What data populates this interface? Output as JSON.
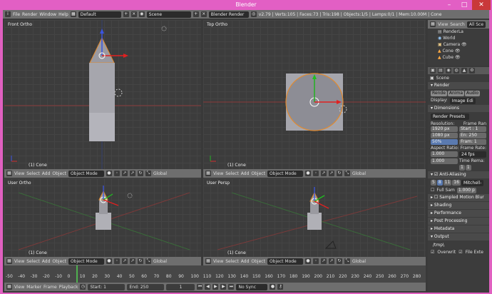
{
  "window": {
    "title": "Blender"
  },
  "menubar": {
    "items": [
      "File",
      "Render",
      "Window",
      "Help"
    ],
    "screen_layout": "Default",
    "scene": "Scene",
    "engine": "Blender Render",
    "stats": "v2.79 | Verts:105 | Faces:73 | Tris:198 | Objects:1/5 | Lamps:0/1 | Mem:10.00M | Cone"
  },
  "viewports": [
    {
      "label": "Front Ortho",
      "object": "(1) Cone"
    },
    {
      "label": "Top Ortho",
      "object": "(1) Cone"
    },
    {
      "label": "User Ortho",
      "object": "(1) Cone"
    },
    {
      "label": "User Persp",
      "object": "(1) Cone"
    }
  ],
  "vp_header": {
    "view": "View",
    "select": "Select",
    "add": "Add",
    "object": "Object",
    "mode": "Object Mode",
    "orientation": "Global"
  },
  "outliner": {
    "view": "View",
    "search": "Search",
    "all_scenes": "All Sce",
    "items": [
      "RenderLa",
      "World",
      "Camera",
      "Cone",
      "Cube"
    ]
  },
  "properties": {
    "scene_label": "Scene",
    "render": {
      "title": "Render",
      "buttons": [
        "Rende",
        "Anima",
        "Audio"
      ],
      "display_label": "Display:",
      "display_value": "Image Edi"
    },
    "dimensions": {
      "title": "Dimensions",
      "presets": "Render Presets",
      "resolution_label": "Resolution:",
      "frame_range_label": "Frame Ran",
      "res_x": "1920 px",
      "res_y": "1080 px",
      "res_pct": "50%",
      "start": "Start : 1",
      "end": "En: 250",
      "frame": "Fram: 1",
      "aspect_label": "Aspect Ratio:",
      "framerate_label": "Frame Rate:",
      "aspect_x": "1.000",
      "aspect_y": "1.000",
      "fps": "24 fps",
      "time_remap": "Time Rema:",
      "remap_old": "1",
      "remap_new": "1"
    },
    "antialias": {
      "title": "Anti-Aliasing",
      "samples": [
        "5",
        "8",
        "11",
        "16"
      ],
      "filter": "Mitchell-",
      "full_sample": "Full Sam",
      "filter_size": "1.000 p"
    },
    "sections": [
      "Sampled Motion Blur",
      "Shading",
      "Performance",
      "Post Processing",
      "Metadata",
      "Output"
    ],
    "output_path": "/tmp\\",
    "overwrite": "Overwrit",
    "file_ext": "File Exte"
  },
  "timeline": {
    "ticks": [
      "-50",
      "-40",
      "-30",
      "-20",
      "-10",
      "0",
      "10",
      "20",
      "30",
      "40",
      "50",
      "60",
      "70",
      "80",
      "90",
      "100",
      "110",
      "120",
      "130",
      "140",
      "150",
      "160",
      "170",
      "180",
      "190",
      "200",
      "210",
      "220",
      "230",
      "240",
      "250",
      "260",
      "270",
      "280"
    ],
    "view": "View",
    "marker": "Marker",
    "frame": "Frame",
    "playback": "Playback",
    "start": "Start:",
    "start_val": "1",
    "end": "End:",
    "end_val": "250",
    "current": "1",
    "sync": "No Sync"
  }
}
